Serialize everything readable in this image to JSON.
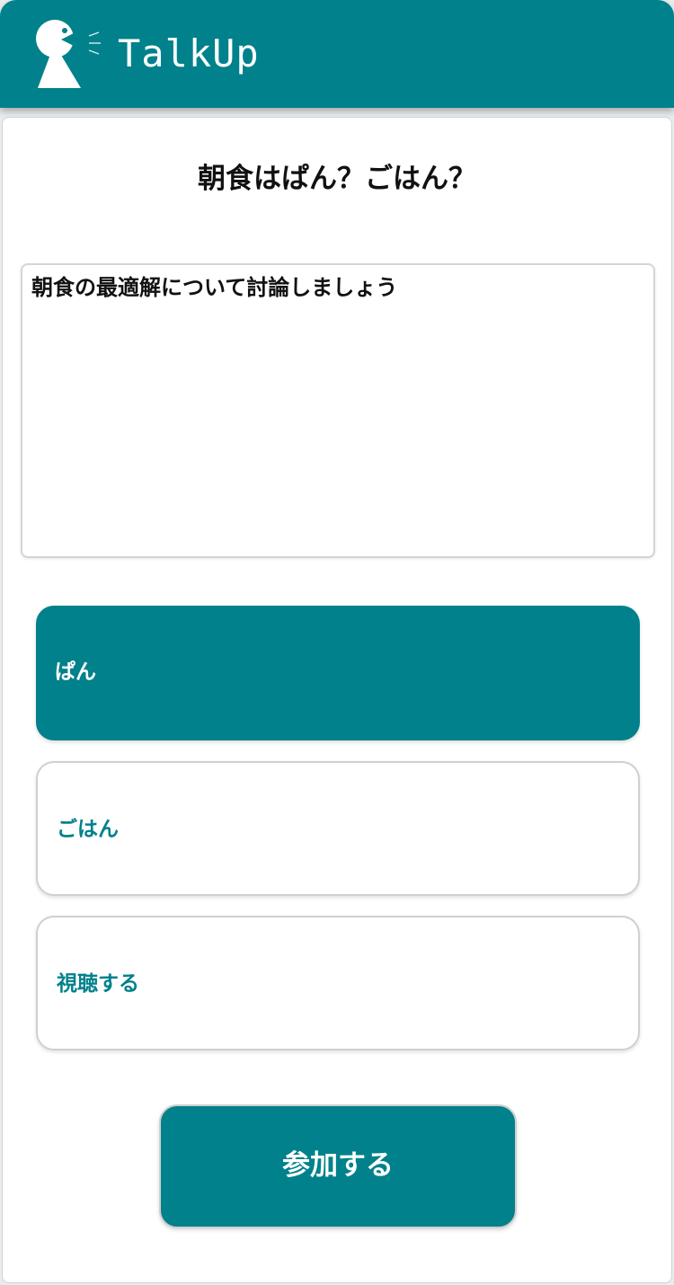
{
  "header": {
    "app_title": "TalkUp",
    "logo_icon": "speaking-person-icon",
    "background_color": "#00818b"
  },
  "room": {
    "title": "朝食はぱん？ごはん？",
    "description": "朝食の最適解について討論しましょう"
  },
  "options": [
    {
      "label": "ぱん",
      "selected": true
    },
    {
      "label": "ごはん",
      "selected": false
    },
    {
      "label": "視聴する",
      "selected": false
    }
  ],
  "join_button": {
    "label": "参加する"
  },
  "colors": {
    "accent": "#00818b",
    "text": "#111111",
    "border": "#d0d0d0"
  }
}
